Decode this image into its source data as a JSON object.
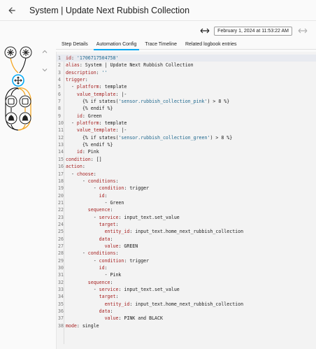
{
  "header": {
    "title": "System | Update Next Rubbish Collection"
  },
  "date_bar": {
    "datetime": "February 1, 2024 at 11:53:22 AM"
  },
  "tabs": [
    {
      "label": "Step Details",
      "active": false
    },
    {
      "label": "Automation Config",
      "active": true
    },
    {
      "label": "Trace Timeline",
      "active": false
    },
    {
      "label": "Related logbook entries",
      "active": false
    }
  ],
  "colors": {
    "accent": "#03a9f4",
    "trace_path": "#f5a623",
    "yaml_key": "#a51f1f",
    "yaml_string": "#21698f"
  },
  "code_lines": [
    {
      "n": "1",
      "parts": [
        [
          "k",
          "id"
        ],
        [
          "p",
          ": "
        ],
        [
          "s",
          "'1706717504758'"
        ]
      ]
    },
    {
      "n": "2",
      "parts": [
        [
          "k",
          "alias"
        ],
        [
          "p",
          ": System | Update Next Rubbish Collection"
        ]
      ]
    },
    {
      "n": "3",
      "parts": [
        [
          "k",
          "description"
        ],
        [
          "p",
          ": "
        ],
        [
          "s",
          "''"
        ]
      ]
    },
    {
      "n": "4",
      "parts": [
        [
          "k",
          "trigger"
        ],
        [
          "p",
          ":"
        ]
      ]
    },
    {
      "n": "5",
      "parts": [
        [
          "p",
          "  - "
        ],
        [
          "k",
          "platform"
        ],
        [
          "p",
          ": template"
        ]
      ]
    },
    {
      "n": "6",
      "parts": [
        [
          "p",
          "    "
        ],
        [
          "k",
          "value_template"
        ],
        [
          "p",
          ": |-"
        ]
      ]
    },
    {
      "n": "7",
      "parts": [
        [
          "p",
          "      {% if states("
        ],
        [
          "s",
          "'sensor.rubbish_collection_pink'"
        ],
        [
          "p",
          ") > 8 %}"
        ]
      ]
    },
    {
      "n": "8",
      "parts": [
        [
          "p",
          "      {% endif %}"
        ]
      ]
    },
    {
      "n": "9",
      "parts": [
        [
          "p",
          "    "
        ],
        [
          "k",
          "id"
        ],
        [
          "p",
          ": Green"
        ]
      ]
    },
    {
      "n": "10",
      "parts": [
        [
          "p",
          "  - "
        ],
        [
          "k",
          "platform"
        ],
        [
          "p",
          ": template"
        ]
      ]
    },
    {
      "n": "11",
      "parts": [
        [
          "p",
          "    "
        ],
        [
          "k",
          "value_template"
        ],
        [
          "p",
          ": |-"
        ]
      ]
    },
    {
      "n": "12",
      "parts": [
        [
          "p",
          "      {% if states("
        ],
        [
          "s",
          "'sensor.rubbish_collection_green'"
        ],
        [
          "p",
          ") > 8 %}"
        ]
      ]
    },
    {
      "n": "13",
      "parts": [
        [
          "p",
          "      {% endif %}"
        ]
      ]
    },
    {
      "n": "14",
      "parts": [
        [
          "p",
          "    "
        ],
        [
          "k",
          "id"
        ],
        [
          "p",
          ": Pink"
        ]
      ]
    },
    {
      "n": "15",
      "parts": [
        [
          "k",
          "condition"
        ],
        [
          "p",
          ": []"
        ]
      ]
    },
    {
      "n": "16",
      "parts": [
        [
          "k",
          "action"
        ],
        [
          "p",
          ":"
        ]
      ]
    },
    {
      "n": "17",
      "parts": [
        [
          "p",
          "  - "
        ],
        [
          "k",
          "choose"
        ],
        [
          "p",
          ":"
        ]
      ]
    },
    {
      "n": "18",
      "parts": [
        [
          "p",
          "      - "
        ],
        [
          "k",
          "conditions"
        ],
        [
          "p",
          ":"
        ]
      ]
    },
    {
      "n": "19",
      "parts": [
        [
          "p",
          "          - "
        ],
        [
          "k",
          "condition"
        ],
        [
          "p",
          ": trigger"
        ]
      ]
    },
    {
      "n": "20",
      "parts": [
        [
          "p",
          "            "
        ],
        [
          "k",
          "id"
        ],
        [
          "p",
          ":"
        ]
      ]
    },
    {
      "n": "21",
      "parts": [
        [
          "p",
          "              - Green"
        ]
      ]
    },
    {
      "n": "22",
      "parts": [
        [
          "p",
          "        "
        ],
        [
          "k",
          "sequence"
        ],
        [
          "p",
          ":"
        ]
      ]
    },
    {
      "n": "23",
      "parts": [
        [
          "p",
          "          - "
        ],
        [
          "k",
          "service"
        ],
        [
          "p",
          ": input_text.set_value"
        ]
      ]
    },
    {
      "n": "24",
      "parts": [
        [
          "p",
          "            "
        ],
        [
          "k",
          "target"
        ],
        [
          "p",
          ":"
        ]
      ]
    },
    {
      "n": "25",
      "parts": [
        [
          "p",
          "              "
        ],
        [
          "k",
          "entity_id"
        ],
        [
          "p",
          ": input_text.home_next_rubbish_collection"
        ]
      ]
    },
    {
      "n": "26",
      "parts": [
        [
          "p",
          "            "
        ],
        [
          "k",
          "data"
        ],
        [
          "p",
          ":"
        ]
      ]
    },
    {
      "n": "27",
      "parts": [
        [
          "p",
          "              "
        ],
        [
          "k",
          "value"
        ],
        [
          "p",
          ": GREEN"
        ]
      ]
    },
    {
      "n": "28",
      "parts": [
        [
          "p",
          "      - "
        ],
        [
          "k",
          "conditions"
        ],
        [
          "p",
          ":"
        ]
      ]
    },
    {
      "n": "29",
      "parts": [
        [
          "p",
          "          - "
        ],
        [
          "k",
          "condition"
        ],
        [
          "p",
          ": trigger"
        ]
      ]
    },
    {
      "n": "30",
      "parts": [
        [
          "p",
          "            "
        ],
        [
          "k",
          "id"
        ],
        [
          "p",
          ":"
        ]
      ]
    },
    {
      "n": "31",
      "parts": [
        [
          "p",
          "              - Pink"
        ]
      ]
    },
    {
      "n": "32",
      "parts": [
        [
          "p",
          "        "
        ],
        [
          "k",
          "sequence"
        ],
        [
          "p",
          ":"
        ]
      ]
    },
    {
      "n": "33",
      "parts": [
        [
          "p",
          "          - "
        ],
        [
          "k",
          "service"
        ],
        [
          "p",
          ": input_text.set_value"
        ]
      ]
    },
    {
      "n": "34",
      "parts": [
        [
          "p",
          "            "
        ],
        [
          "k",
          "target"
        ],
        [
          "p",
          ":"
        ]
      ]
    },
    {
      "n": "35",
      "parts": [
        [
          "p",
          "              "
        ],
        [
          "k",
          "entity_id"
        ],
        [
          "p",
          ": input_text.home_next_rubbish_collection"
        ]
      ]
    },
    {
      "n": "36",
      "parts": [
        [
          "p",
          "            "
        ],
        [
          "k",
          "data"
        ],
        [
          "p",
          ":"
        ]
      ]
    },
    {
      "n": "37",
      "parts": [
        [
          "p",
          "              "
        ],
        [
          "k",
          "value"
        ],
        [
          "p",
          ": PINK and BLACK"
        ]
      ]
    },
    {
      "n": "38",
      "parts": [
        [
          "k",
          "mode"
        ],
        [
          "p",
          ": single"
        ]
      ]
    }
  ]
}
